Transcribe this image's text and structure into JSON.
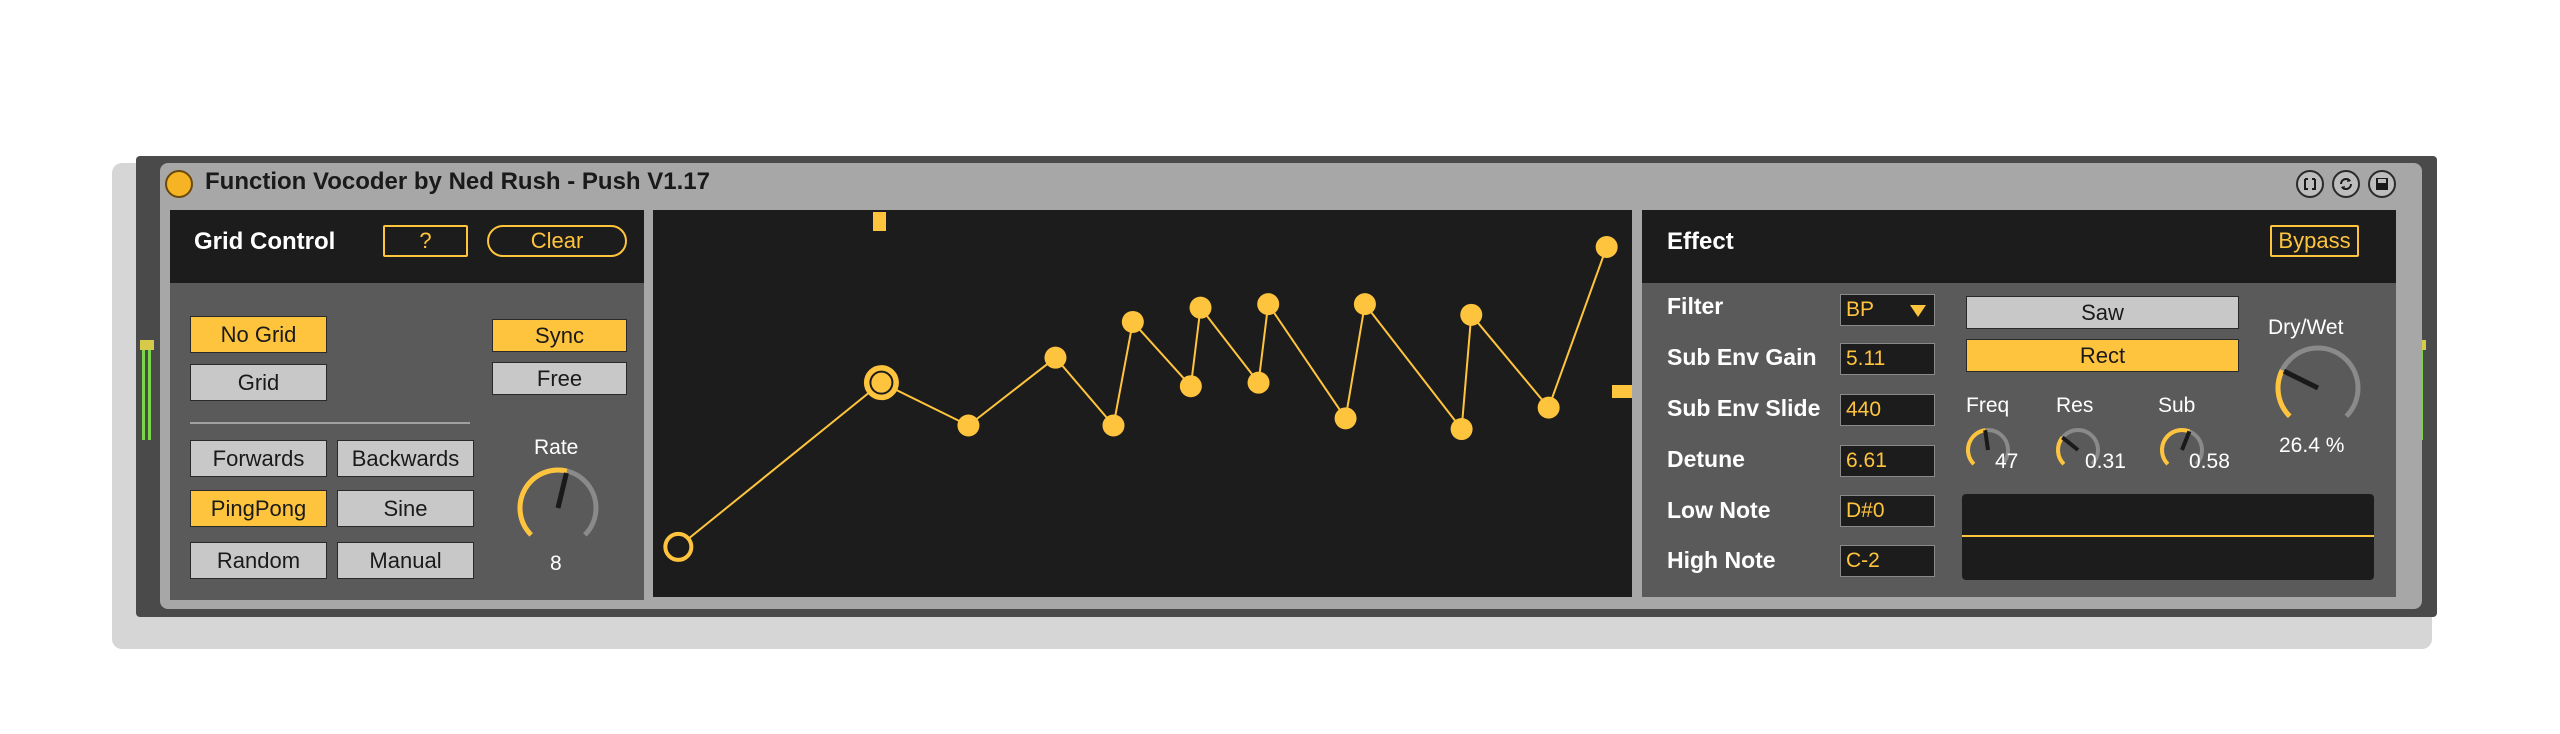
{
  "device": {
    "title": "Function Vocoder by Ned Rush - Push V1.17",
    "header_icons": [
      "bracket-icon",
      "refresh-icon",
      "save-icon"
    ]
  },
  "colors": {
    "accent": "#ffc43d",
    "panel": "#5a5a5a",
    "dark": "#1c1c1c",
    "button": "#c8c8c8"
  },
  "grid_control": {
    "title": "Grid Control",
    "help_label": "?",
    "clear_label": "Clear",
    "no_grid_label": "No Grid",
    "grid_label": "Grid",
    "sync_label": "Sync",
    "free_label": "Free",
    "forwards_label": "Forwards",
    "backwards_label": "Backwards",
    "pingpong_label": "PingPong",
    "sine_label": "Sine",
    "random_label": "Random",
    "manual_label": "Manual",
    "rate_label": "Rate",
    "rate_value": "8",
    "rate_fraction": 0.55
  },
  "envelope": {
    "points": [
      [
        0.02,
        0.09
      ],
      [
        0.23,
        0.55
      ],
      [
        0.32,
        0.43
      ],
      [
        0.41,
        0.62
      ],
      [
        0.47,
        0.43
      ],
      [
        0.49,
        0.72
      ],
      [
        0.55,
        0.54
      ],
      [
        0.56,
        0.76
      ],
      [
        0.62,
        0.55
      ],
      [
        0.63,
        0.77
      ],
      [
        0.71,
        0.45
      ],
      [
        0.73,
        0.77
      ],
      [
        0.83,
        0.42
      ],
      [
        0.84,
        0.74
      ],
      [
        0.92,
        0.48
      ],
      [
        0.98,
        0.93
      ]
    ],
    "selected_index": 1
  },
  "effect": {
    "title": "Effect",
    "bypass_label": "Bypass",
    "filter_label": "Filter",
    "filter_value": "BP",
    "sub_env_gain_label": "Sub Env Gain",
    "sub_env_gain_value": "5.11",
    "sub_env_slide_label": "Sub Env Slide",
    "sub_env_slide_value": "440",
    "detune_label": "Detune",
    "detune_value": "6.61",
    "low_note_label": "Low Note",
    "low_note_value": "D#0",
    "high_note_label": "High Note",
    "high_note_value": "C-2",
    "saw_label": "Saw",
    "rect_label": "Rect",
    "freq_label": "Freq",
    "freq_value": "47",
    "res_label": "Res",
    "res_value": "0.31",
    "sub_label": "Sub",
    "sub_value": "0.58",
    "drywet_label": "Dry/Wet",
    "drywet_value": "26.4 %",
    "drywet_fraction": 0.264
  }
}
